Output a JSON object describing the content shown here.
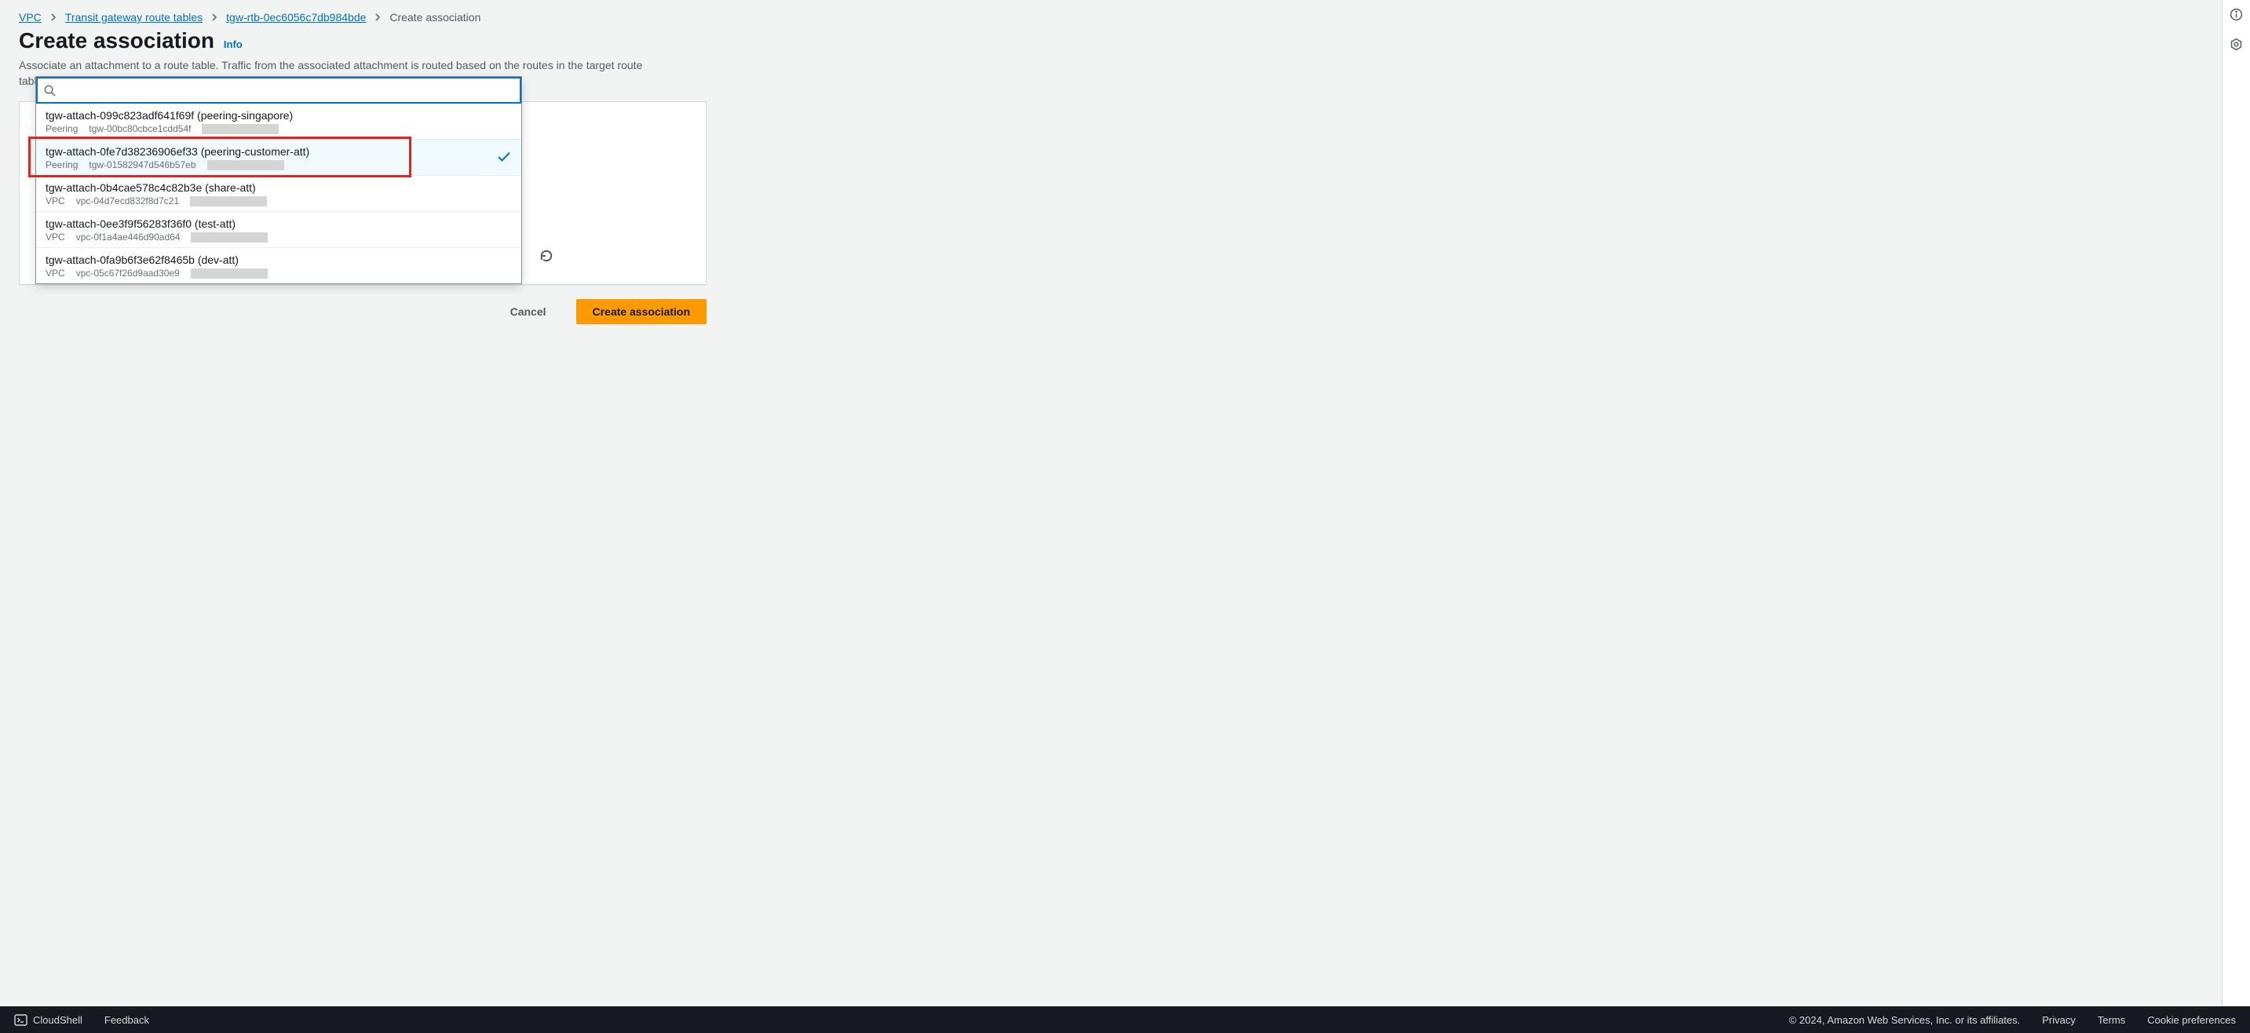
{
  "breadcrumbs": {
    "items": [
      {
        "label": "VPC",
        "link": true
      },
      {
        "label": "Transit gateway route tables",
        "link": true
      },
      {
        "label": "tgw-rtb-0ec6056c7db984bde",
        "link": true
      },
      {
        "label": "Create association",
        "link": false
      }
    ]
  },
  "page": {
    "title": "Create association",
    "info": "Info",
    "description": "Associate an attachment to a route table. Traffic from the associated attachment is routed based on the routes in the target route table. An attachment can only be associated to one route table."
  },
  "select": {
    "value": "tgw-attach-0fe7d38236906ef33",
    "searchValue": ""
  },
  "dropdown": {
    "options": [
      {
        "primary": "tgw-attach-099c823adf641f69f (peering-singapore)",
        "type": "Peering",
        "resource": "tgw-00bc80cbce1cdd54f",
        "selected": false
      },
      {
        "primary": "tgw-attach-0fe7d38236906ef33 (peering-customer-att)",
        "type": "Peering",
        "resource": "tgw-01582947d546b57eb",
        "selected": true
      },
      {
        "primary": "tgw-attach-0b4cae578c4c82b3e (share-att)",
        "type": "VPC",
        "resource": "vpc-04d7ecd832f8d7c21",
        "selected": false
      },
      {
        "primary": "tgw-attach-0ee3f9f56283f36f0 (test-att)",
        "type": "VPC",
        "resource": "vpc-0f1a4ae446d90ad64",
        "selected": false
      },
      {
        "primary": "tgw-attach-0fa9b6f3e62f8465b (dev-att)",
        "type": "VPC",
        "resource": "vpc-05c67f26d9aad30e9",
        "selected": false
      }
    ]
  },
  "actions": {
    "cancel": "Cancel",
    "submit": "Create association"
  },
  "footer": {
    "cloudshell": "CloudShell",
    "feedback": "Feedback",
    "copyright": "© 2024, Amazon Web Services, Inc. or its affiliates.",
    "privacy": "Privacy",
    "terms": "Terms",
    "cookies": "Cookie preferences"
  }
}
